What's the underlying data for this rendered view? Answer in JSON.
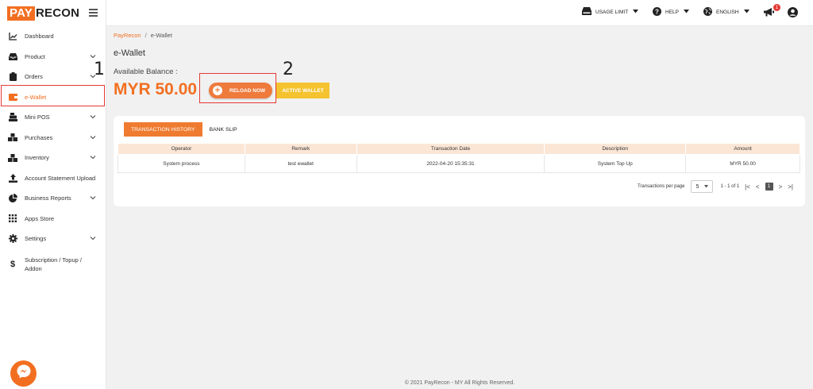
{
  "brand": {
    "pay": "PAY",
    "recon": "RECON"
  },
  "sidebar": {
    "items": [
      {
        "label": "Dashboard"
      },
      {
        "label": "Product"
      },
      {
        "label": "Orders"
      },
      {
        "label": "e-Wallet"
      },
      {
        "label": "Mini POS"
      },
      {
        "label": "Purchases"
      },
      {
        "label": "Inventory"
      },
      {
        "label": "Account Statement Upload"
      },
      {
        "label": "Business Reports"
      },
      {
        "label": "Apps Store"
      },
      {
        "label": "Settings"
      },
      {
        "label": "Subscription / Topup / Addon"
      }
    ]
  },
  "annotations": {
    "one": "1",
    "two": "2"
  },
  "topbar": {
    "usage_limit": "USAGE LIMIT",
    "help": "HELP",
    "language": "ENGLISH",
    "notification_count": "1"
  },
  "breadcrumb": {
    "root": "PayRecon",
    "separator": "/",
    "current": "e-Wallet"
  },
  "page": {
    "title": "e-Wallet",
    "available_label": "Available Balance :",
    "balance": "MYR 50.00",
    "reload_label": "RELOAD NOW",
    "active_wallet_label": "ACTIVE WALLET"
  },
  "tabs": {
    "history": "TRANSACTION HISTORY",
    "bank_slip": "BANK SLIP"
  },
  "table": {
    "columns": [
      "Operator",
      "Remark",
      "Transaction Date",
      "Description",
      "Amount"
    ],
    "rows": [
      [
        "System process",
        "test ewallet",
        "2022-04-20 15:35:31",
        "System Top Up",
        "MYR 50.00"
      ]
    ]
  },
  "pagination": {
    "per_page_label": "Transactions per page",
    "per_page": "5",
    "range": "1 - 1 of 1",
    "current_page": "1"
  },
  "footer": "© 2021 PayRecon - MY All Rights Reserved.",
  "colors": {
    "accent": "#f26f21",
    "warning": "#f4c32f",
    "highlight": "#e53935"
  }
}
